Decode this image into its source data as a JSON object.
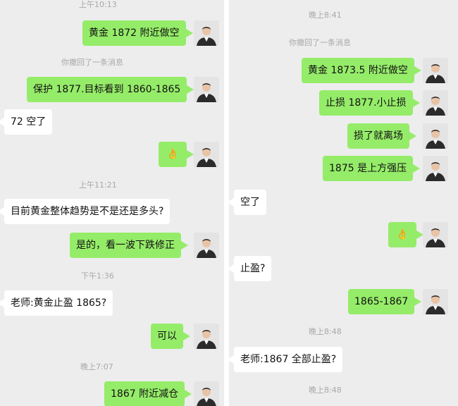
{
  "left": {
    "timestamps": [
      "上午10:13",
      "上午11:21",
      "下午1:36",
      "晚上7:07"
    ],
    "system_notice": "你撤回了一条消息",
    "messages": [
      "黄金 1872 附近做空",
      "保护 1877.目标看到 1860-1865",
      "72 空了",
      "👌",
      "目前黄金整体趋势是不是还是多头?",
      "是的，看一波下跌修正",
      "老师:黄金止盈 1865?",
      "可以",
      "1867 附近减仓"
    ]
  },
  "right": {
    "timestamps": [
      "晚上8:41",
      "晚上8:48",
      "晚上8:48"
    ],
    "system_notice": "你撤回了一条消息",
    "messages": [
      "黄金 1873.5 附近做空",
      "止损 1877.小止损",
      "损了就离场",
      "1875 是上方强压",
      "空了",
      "👌",
      "止盈?",
      "1865-1867",
      "老师:1867 全部止盈?"
    ]
  },
  "colors": {
    "chat_background": "#ededed",
    "outgoing_bubble": "#95ec69",
    "incoming_bubble": "#ffffff",
    "timestamp_text": "#a8a8a8"
  },
  "icons": {
    "avatar": "user-avatar-icon",
    "reaction": "ok-hand-emoji"
  }
}
